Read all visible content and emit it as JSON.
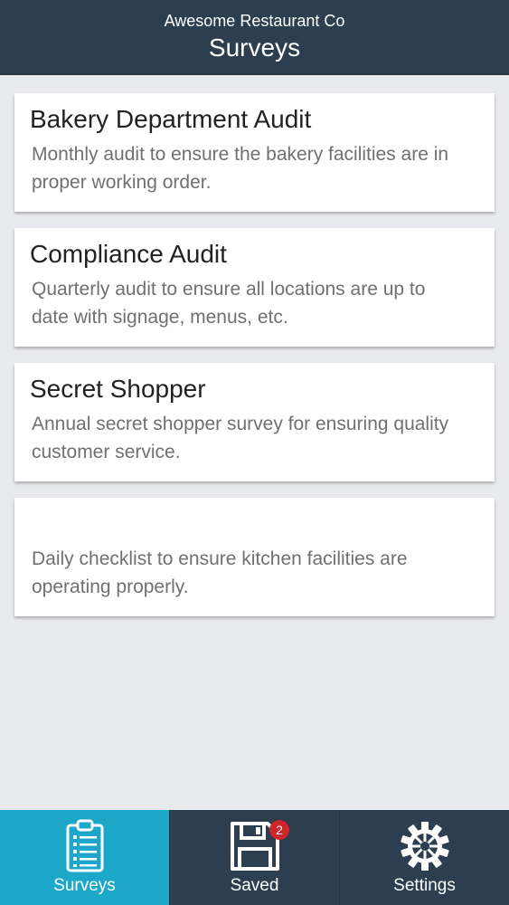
{
  "header": {
    "company": "Awesome Restaurant Co",
    "title": "Surveys"
  },
  "surveys": [
    {
      "title": "Bakery Department Audit",
      "description": "Monthly audit to ensure the bakery facilities are in proper working order."
    },
    {
      "title": "Compliance Audit",
      "description": "Quarterly audit to ensure all locations are up to date with signage, menus, etc."
    },
    {
      "title": "Secret Shopper",
      "description": "Annual secret shopper survey for ensuring quality customer service."
    },
    {
      "title": "",
      "description": "Daily checklist to ensure kitchen facilities are operating properly."
    }
  ],
  "tabs": [
    {
      "label": "Surveys",
      "icon": "clipboard-icon",
      "active": true
    },
    {
      "label": "Saved",
      "icon": "floppy-disk-icon",
      "badge": "2"
    },
    {
      "label": "Settings",
      "icon": "gear-icon"
    }
  ],
  "colors": {
    "header_bg": "#2c3e50",
    "active_tab": "#1da8c9",
    "badge": "#d0252a",
    "page_bg": "#e9eaee"
  }
}
